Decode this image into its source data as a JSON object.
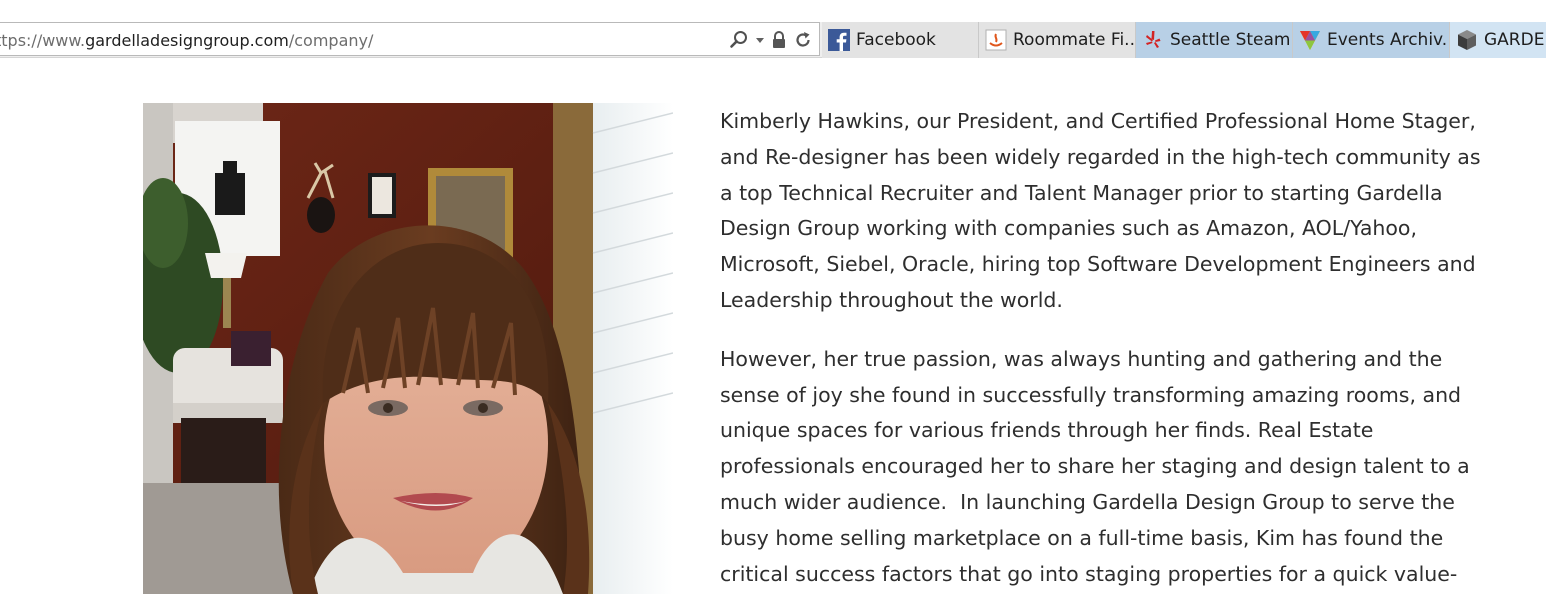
{
  "browser": {
    "address_bar": {
      "url_prefix": "ttps://www.",
      "url_host": "gardelladesigngroup.com",
      "url_path": "/company/"
    },
    "address_icons": [
      "search-icon",
      "dropdown-arrow-icon",
      "lock-icon",
      "refresh-icon"
    ],
    "tabs": [
      {
        "label": "Facebook",
        "icon": "facebook-icon",
        "state": "inactive"
      },
      {
        "label": "Roommate Fi...",
        "icon": "roommate-site-icon",
        "state": "inactive"
      },
      {
        "label": "Seattle Steam...",
        "icon": "yelp-icon",
        "state": "selected"
      },
      {
        "label": "Events Archiv...",
        "icon": "colorful-triangle-icon",
        "state": "selected"
      },
      {
        "label": "GARDEL",
        "icon": "cube-icon",
        "state": "active"
      }
    ]
  },
  "page": {
    "photo": {
      "name": "portrait-photo",
      "alt_subject": "portrait"
    },
    "paragraphs": [
      {
        "lines": [
          "Kimberly Hawkins, our President, and Certified Professional Home Stager,",
          "and Re-designer has been widely regarded in the high-tech community as",
          "a top Technical Recruiter and Talent Manager prior to starting Gardella",
          "Design Group working with companies such as Amazon, AOL/Yahoo,",
          "Microsoft, Siebel, Oracle, hiring top Software Development Engineers and",
          "Leadership throughout the world."
        ]
      },
      {
        "lines": [
          "However, her true passion, was always hunting and gathering and the",
          "sense of joy she found in successfully transforming amazing rooms, and",
          "unique spaces for various friends through her finds. Real Estate",
          "professionals encouraged her to share her staging and design talent to a",
          "much wider audience.  In launching Gardella Design Group to serve the",
          "busy home selling marketplace on a full-time basis, Kim has found the",
          "critical success factors that go into staging properties for a quick value-"
        ]
      }
    ]
  }
}
